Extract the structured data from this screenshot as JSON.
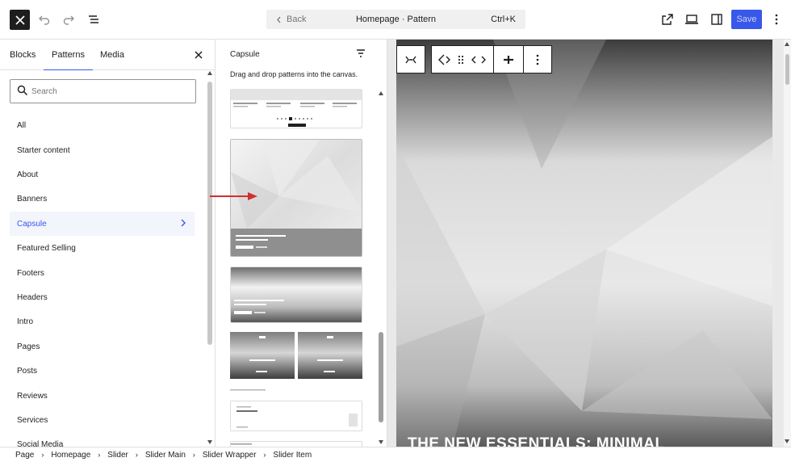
{
  "topbar": {
    "back_label": "Back",
    "title": "Homepage · Pattern",
    "shortcut": "Ctrl+K",
    "save_label": "Save",
    "accent": "#3858e9"
  },
  "sidebar": {
    "tabs": [
      {
        "label": "Blocks"
      },
      {
        "label": "Patterns",
        "active": true
      },
      {
        "label": "Media"
      }
    ],
    "search_placeholder": "Search",
    "categories": [
      {
        "label": "All"
      },
      {
        "label": "Starter content"
      },
      {
        "label": "About"
      },
      {
        "label": "Banners"
      },
      {
        "label": "Capsule",
        "selected": true
      },
      {
        "label": "Featured Selling"
      },
      {
        "label": "Footers"
      },
      {
        "label": "Headers"
      },
      {
        "label": "Intro"
      },
      {
        "label": "Pages"
      },
      {
        "label": "Posts"
      },
      {
        "label": "Reviews"
      },
      {
        "label": "Services"
      },
      {
        "label": "Social Media"
      }
    ]
  },
  "patterns_panel": {
    "title": "Capsule",
    "description": "Drag and drop patterns into the canvas."
  },
  "canvas": {
    "hero_heading": "THE NEW ESSENTIALS: MINIMAL"
  },
  "breadcrumb": [
    "Page",
    "Homepage",
    "Slider",
    "Slider Main",
    "Slider Wrapper",
    "Slider Item"
  ],
  "icons": [
    "close-icon",
    "undo-icon",
    "redo-icon",
    "document-overview-icon",
    "chevron-left-icon",
    "external-link-icon",
    "laptop-icon",
    "sidebar-icon",
    "more-vertical-icon",
    "search-icon",
    "chevron-right-icon",
    "filter-icon",
    "parent-block-icon",
    "slider-block-icon",
    "drag-handle-icon",
    "move-arrows-icon",
    "align-icon",
    "red-arrow-icon"
  ]
}
